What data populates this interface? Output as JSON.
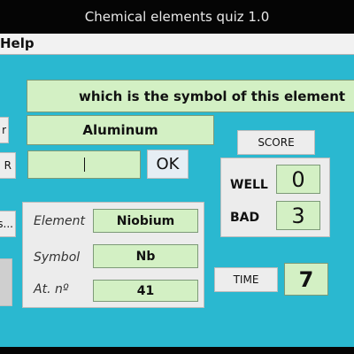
{
  "window": {
    "title": "Chemical elements quiz 1.0"
  },
  "menu": {
    "help": "Help"
  },
  "question": "which is the symbol of this element",
  "current_element": "Aluminum",
  "answer_input": {
    "value": ""
  },
  "ok_label": "OK",
  "left_buttons": {
    "btn_top": "r",
    "btn_mid": "R",
    "btn_low": "s..."
  },
  "score": {
    "button_label": "SCORE",
    "well_label": "WELL",
    "well_value": "0",
    "bad_label": "BAD",
    "bad_value": "3"
  },
  "previous": {
    "element_label": "Element",
    "element_value": "Niobium",
    "symbol_label": "Symbol",
    "symbol_value": "Nb",
    "atomic_label": "At. nº",
    "atomic_value": "41"
  },
  "time": {
    "button_label": "TIME",
    "value": "7"
  }
}
